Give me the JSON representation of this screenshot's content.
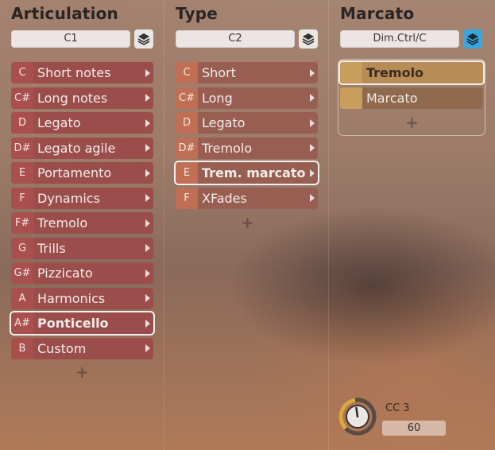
{
  "articulation": {
    "title": "Articulation",
    "key_value": "C1",
    "items": [
      {
        "key": "C",
        "label": "Short notes"
      },
      {
        "key": "C#",
        "label": "Long notes"
      },
      {
        "key": "D",
        "label": "Legato"
      },
      {
        "key": "D#",
        "label": "Legato agile"
      },
      {
        "key": "E",
        "label": "Portamento"
      },
      {
        "key": "F",
        "label": "Dynamics"
      },
      {
        "key": "F#",
        "label": "Tremolo"
      },
      {
        "key": "G",
        "label": "Trills"
      },
      {
        "key": "G#",
        "label": "Pizzicato"
      },
      {
        "key": "A",
        "label": "Harmonics"
      },
      {
        "key": "A#",
        "label": "Ponticello"
      },
      {
        "key": "B",
        "label": "Custom"
      }
    ],
    "selected_index": 10,
    "add_label": "+"
  },
  "type": {
    "title": "Type",
    "key_value": "C2",
    "items": [
      {
        "key": "C",
        "label": "Short"
      },
      {
        "key": "C#",
        "label": "Long"
      },
      {
        "key": "D",
        "label": "Legato"
      },
      {
        "key": "D#",
        "label": "Tremolo"
      },
      {
        "key": "E",
        "label": "Trem. marcato"
      },
      {
        "key": "F",
        "label": "XFades"
      }
    ],
    "selected_index": 4,
    "add_label": "+"
  },
  "marcato": {
    "title": "Marcato",
    "key_value": "Dim.Ctrl/C",
    "items": [
      {
        "label": "Tremolo"
      },
      {
        "label": "Marcato"
      }
    ],
    "selected_index": 0,
    "add_label": "+",
    "knob": {
      "label": "CC 3",
      "value": "60",
      "level": 0.47
    }
  },
  "icons": {
    "layers": "layers-icon",
    "arrow": "chevron-right-icon",
    "knob": "knob-icon"
  },
  "colors": {
    "accent_active": "#3aa6dc",
    "knob_arc": "#d9a93c"
  }
}
